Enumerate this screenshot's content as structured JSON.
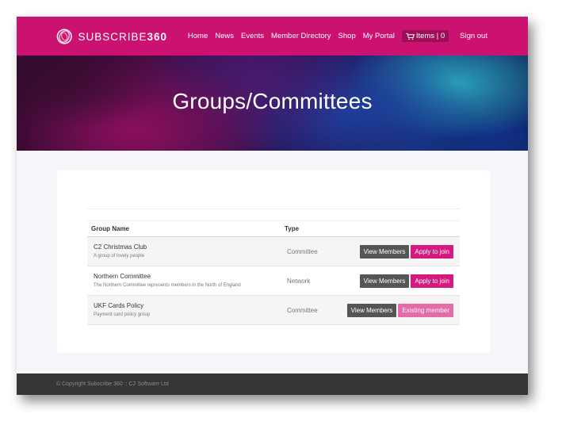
{
  "logo": {
    "text_light": "SUBSCRIBE",
    "text_bold": "360"
  },
  "nav": {
    "items": [
      "Home",
      "News",
      "Events",
      "Member Directory",
      "Shop",
      "My Portal"
    ],
    "cart_label": "Items | 0",
    "signout": "Sign out"
  },
  "hero": {
    "title": "Groups/Committees"
  },
  "table": {
    "headers": {
      "name": "Group Name",
      "type": "Type"
    },
    "rows": [
      {
        "name": "C2 Christmas Club",
        "description": "A group of lovely people",
        "type": "Committee",
        "view_label": "View Members",
        "action_label": "Apply to join"
      },
      {
        "name": "Northern Committee",
        "description": "The Northern Committee represents members in the North of England",
        "type": "Network",
        "view_label": "View Members",
        "action_label": "Apply to join"
      },
      {
        "name": "UKF Cards Policy",
        "description": "Payment card policy group",
        "type": "Committee",
        "view_label": "View Members",
        "action_label": "Existing member"
      }
    ]
  },
  "footer": {
    "copyright": "© Copyright Subscribe 360 :: C2 Software Ltd"
  },
  "colors": {
    "brand": "#cc1271",
    "button_dark": "#555555",
    "button_pink": "#d41a7f",
    "button_existing": "#e56ba8",
    "footer": "#363636"
  }
}
